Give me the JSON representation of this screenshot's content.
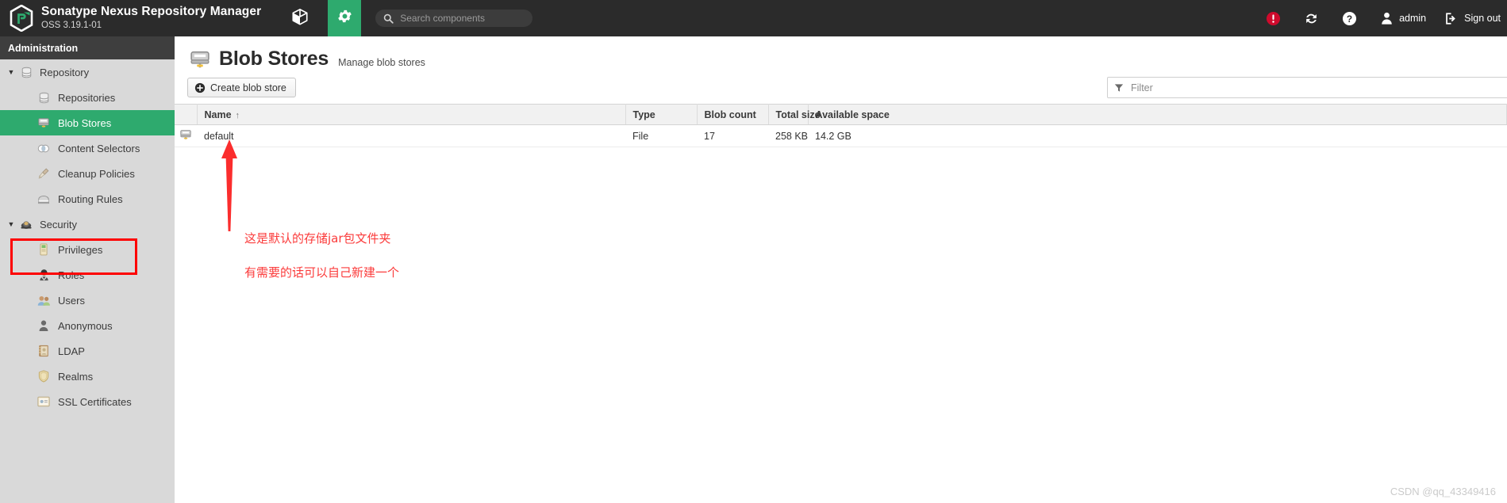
{
  "header": {
    "app_title": "Sonatype Nexus Repository Manager",
    "app_version": "OSS 3.19.1-01",
    "browse_tab_icon": "cube-icon",
    "admin_tab_icon": "gear-icon",
    "search": {
      "placeholder": "Search components",
      "value": "",
      "icon": "search-icon"
    },
    "right_items": [
      {
        "icon": "alert-circle-icon",
        "label": ""
      },
      {
        "icon": "refresh-icon",
        "label": ""
      },
      {
        "icon": "help-circle-icon",
        "label": ""
      },
      {
        "icon": "user-icon",
        "label": "admin"
      },
      {
        "icon": "sign-out-icon",
        "label": "Sign out"
      }
    ],
    "accent_green": "#2eaa6e",
    "alert_red": "#cf0a2c",
    "bar_color": "#2b2b2b"
  },
  "sidebar": {
    "title": "Administration",
    "items": [
      {
        "label": "Repository",
        "icon": "database-icon",
        "level": "group",
        "expanded": true,
        "selected": false
      },
      {
        "label": "Repositories",
        "icon": "database-icon",
        "level": "child",
        "selected": false
      },
      {
        "label": "Blob Stores",
        "icon": "blobstore-icon",
        "level": "child",
        "selected": true
      },
      {
        "label": "Content Selectors",
        "icon": "contrast-icon",
        "level": "child",
        "selected": false
      },
      {
        "label": "Cleanup Policies",
        "icon": "broom-icon",
        "level": "child",
        "selected": false
      },
      {
        "label": "Routing Rules",
        "icon": "routing-icon",
        "level": "child",
        "selected": false
      },
      {
        "label": "Security",
        "icon": "security-icon",
        "level": "group",
        "expanded": true,
        "selected": false
      },
      {
        "label": "Privileges",
        "icon": "medal-icon",
        "level": "child",
        "selected": false
      },
      {
        "label": "Roles",
        "icon": "officer-icon",
        "level": "child",
        "selected": false
      },
      {
        "label": "Users",
        "icon": "users-icon",
        "level": "child",
        "selected": false
      },
      {
        "label": "Anonymous",
        "icon": "anonymous-icon",
        "level": "child",
        "selected": false
      },
      {
        "label": "LDAP",
        "icon": "book-icon",
        "level": "child",
        "selected": false
      },
      {
        "label": "Realms",
        "icon": "shield-icon",
        "level": "child",
        "selected": false
      },
      {
        "label": "SSL Certificates",
        "icon": "certificate-icon",
        "level": "child",
        "selected": false
      }
    ],
    "selected_highlight_color": "#2eaa6e",
    "annotation_box_color": "#fe0000"
  },
  "main": {
    "page_icon": "blobstore-icon",
    "page_title": "Blob Stores",
    "page_subtitle": "Manage blob stores",
    "create_button": {
      "label": "Create blob store",
      "icon": "plus-circle-icon"
    },
    "filter": {
      "placeholder": "Filter",
      "value": "",
      "icon": "funnel-icon"
    },
    "table": {
      "columns": [
        {
          "key": "icon",
          "label": ""
        },
        {
          "key": "name",
          "label": "Name",
          "sorted": "asc",
          "sort_glyph": "↑"
        },
        {
          "key": "type",
          "label": "Type"
        },
        {
          "key": "blobcount",
          "label": "Blob count"
        },
        {
          "key": "totalsize",
          "label": "Total size"
        },
        {
          "key": "available",
          "label": "Available space"
        }
      ],
      "rows": [
        {
          "icon": "blobstore-icon",
          "name": "default",
          "type": "File",
          "blobcount": "17",
          "totalsize": "258 KB",
          "available": "14.2 GB"
        }
      ]
    }
  },
  "annotations": {
    "arrow_color": "#fb2d2d",
    "line1": "这是默认的存储jar包文件夹",
    "line2": "有需要的话可以自己新建一个"
  },
  "watermark": "CSDN @qq_43349416"
}
